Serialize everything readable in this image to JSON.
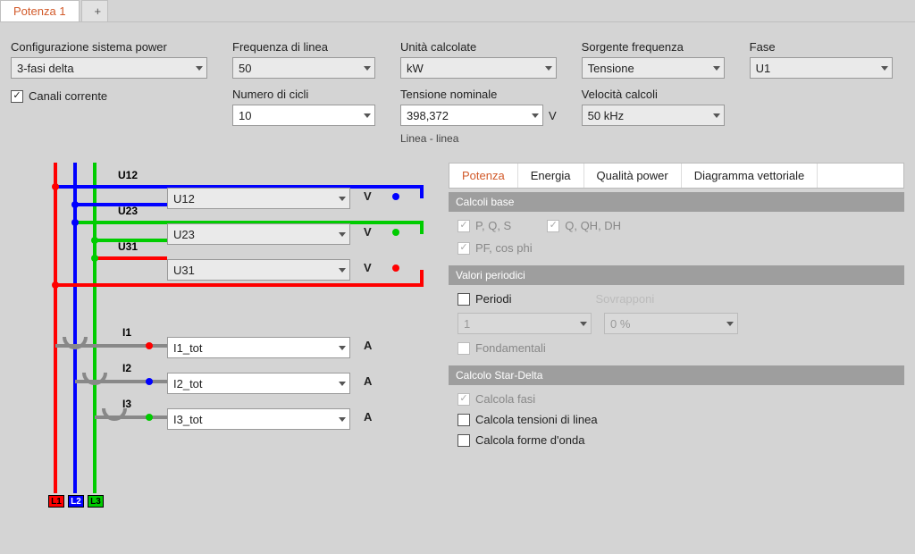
{
  "tabs": {
    "active": "Potenza 1",
    "plus": "+"
  },
  "config": {
    "power_system": {
      "label": "Configurazione sistema power",
      "value": "3-fasi delta"
    },
    "channels_cb": {
      "label": "Canali corrente",
      "checked": true
    },
    "line_freq": {
      "label": "Frequenza di linea",
      "value": "50"
    },
    "cycles": {
      "label": "Numero di cicli",
      "value": "10"
    },
    "calc_units": {
      "label": "Unità calcolate",
      "value": "kW"
    },
    "vnom": {
      "label": "Tensione nominale",
      "value": "398,372",
      "unit": "V",
      "sub": "Linea - linea"
    },
    "freq_src": {
      "label": "Sorgente frequenza",
      "value": "Tensione"
    },
    "calc_rate": {
      "label": "Velocità calcoli",
      "value": "50 kHz"
    },
    "phase": {
      "label": "Fase",
      "value": "U1"
    }
  },
  "diagram": {
    "u": [
      {
        "lbl": "U12",
        "val": "U12",
        "unit": "V"
      },
      {
        "lbl": "U23",
        "val": "U23",
        "unit": "V"
      },
      {
        "lbl": "U31",
        "val": "U31",
        "unit": "V"
      }
    ],
    "i": [
      {
        "lbl": "I1",
        "val": "I1_tot",
        "unit": "A"
      },
      {
        "lbl": "I2",
        "val": "I2_tot",
        "unit": "A"
      },
      {
        "lbl": "I3",
        "val": "I3_tot",
        "unit": "A"
      }
    ],
    "terms": [
      "L1",
      "L2",
      "L3"
    ]
  },
  "right": {
    "tabs": [
      "Potenza",
      "Energia",
      "Qualità power",
      "Diagramma vettoriale"
    ],
    "active_tab": 0,
    "sec1": {
      "title": "Calcoli base",
      "opts": [
        "P, Q, S",
        "Q, QH, DH",
        "PF, cos phi"
      ]
    },
    "sec2": {
      "title": "Valori periodici",
      "periods": "Periodi",
      "periods_val": "1",
      "overlap_lbl": "Sovrapponi",
      "overlap_val": "0 %",
      "fund": "Fondamentali"
    },
    "sec3": {
      "title": "Calcolo Star-Delta",
      "opts": [
        "Calcola fasi",
        "Calcola tensioni di linea",
        "Calcola forme d'onda"
      ]
    }
  }
}
